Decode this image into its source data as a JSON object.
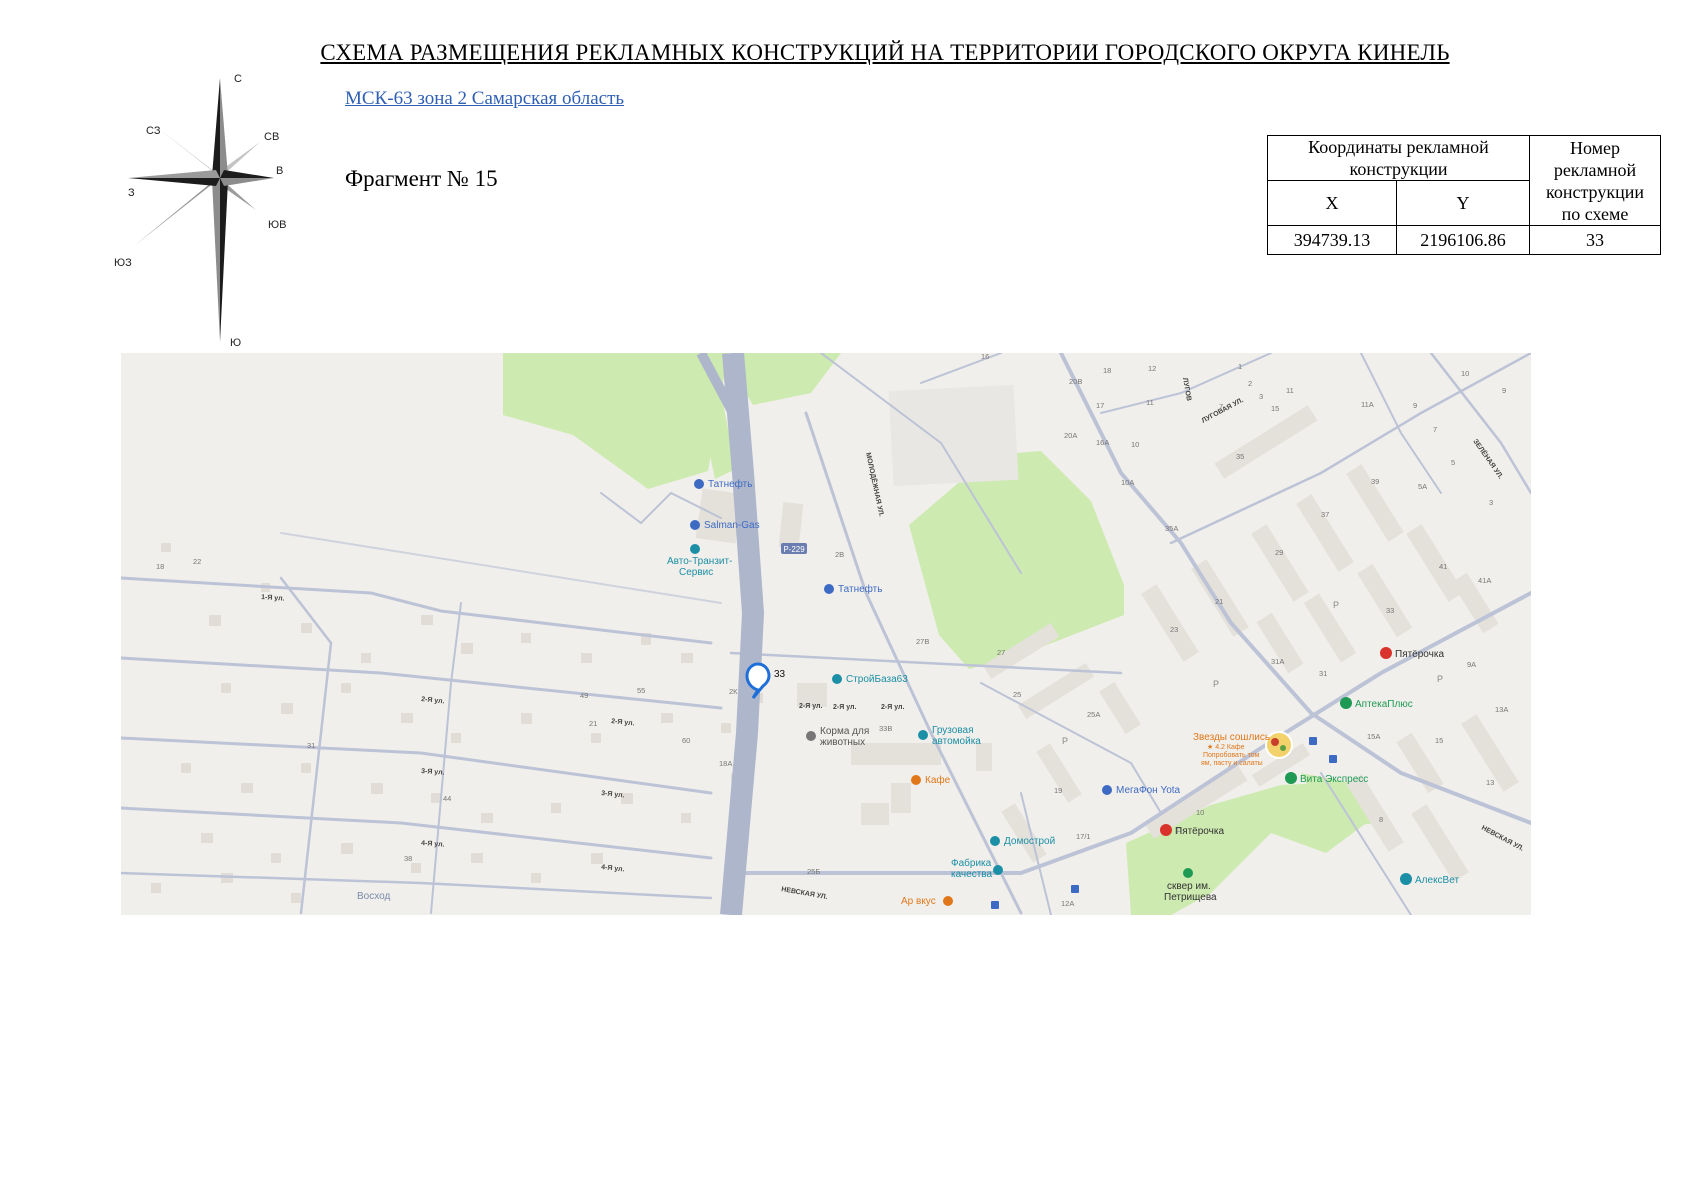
{
  "header": {
    "title": "СХЕМА РАЗМЕЩЕНИЯ РЕКЛАМНЫХ КОНСТРУКЦИЙ НА ТЕРРИТОРИИ ГОРОДСКОГО ОКРУГА КИНЕЛЬ",
    "crs_link": "МСК-63 зона 2 Самарская область",
    "fragment": "Фрагмент № 15"
  },
  "compass": {
    "labels": {
      "n": "С",
      "ne": "СВ",
      "e": "В",
      "se": "ЮВ",
      "s": "Ю",
      "sw": "ЮЗ",
      "w": "З",
      "nw": "СЗ"
    }
  },
  "coords_table": {
    "header_coords": "Координаты рекламной конструкции",
    "header_number": "Номер рекламной конструкции по схеме",
    "col_x": "X",
    "col_y": "Y",
    "rows": [
      {
        "x": "394739.13",
        "y": "2196106.86",
        "number": "33"
      }
    ]
  },
  "map": {
    "marker_label": "33",
    "colors": {
      "park": "#cdeab0",
      "road": "#bcc3d6",
      "highway": "#aeb6cc",
      "building": "#e4e0da",
      "marker": "#1e6fd9",
      "poi_blue": "#3d6bc4",
      "poi_green": "#1f9a55",
      "poi_teal": "#1b8fa6",
      "poi_orange": "#e0781b",
      "poi_red": "#d9342b"
    },
    "route_badge": "Р-229",
    "pois": [
      {
        "name": "Татнефть",
        "icon": "fuel-icon"
      },
      {
        "name": "Salman-Gas",
        "icon": "fuel-icon"
      },
      {
        "name": "Авто-Транзит-",
        "icon": "bus-icon"
      },
      {
        "name": "Сервис",
        "icon": "bus-icon"
      },
      {
        "name": "Татнефть",
        "icon": "fuel-icon"
      },
      {
        "name": "СтройБаза63",
        "icon": "shop-icon"
      },
      {
        "name": "Корма для",
        "icon": "pet-food-icon"
      },
      {
        "name": "животных",
        "icon": "pet-food-icon"
      },
      {
        "name": "Грузовая",
        "icon": "car-service-icon"
      },
      {
        "name": "автомойка",
        "icon": "car-service-icon"
      },
      {
        "name": "Кафе",
        "icon": "cafe-icon"
      },
      {
        "name": "Домострой",
        "icon": "shop-icon"
      },
      {
        "name": "Фабрика",
        "icon": "shop-icon"
      },
      {
        "name": "качества",
        "icon": "shop-icon"
      },
      {
        "name": "Ар вкус",
        "icon": "cafe-icon"
      },
      {
        "name": "МегаФон Yota",
        "icon": "phone-icon"
      },
      {
        "name": "Пятёрочка",
        "icon": "supermarket-icon"
      },
      {
        "name": "Пятёрочка",
        "icon": "supermarket-icon"
      },
      {
        "name": "АптекаПлюс",
        "icon": "pharmacy-icon"
      },
      {
        "name": "Вита Экспресс",
        "icon": "pharmacy-icon"
      },
      {
        "name": "АлексВет",
        "icon": "vet-icon"
      },
      {
        "name": "Звезды сошлись",
        "icon": "restaurant-icon"
      },
      {
        "name": "сквер им.",
        "icon": "park-icon"
      },
      {
        "name": "Петрищева",
        "icon": "park-icon"
      }
    ],
    "promo_lines": [
      "★ 4.2 Кафе",
      "Попробовать том",
      "ям, пасту и салаты"
    ],
    "streets": [
      "1-Я ул.",
      "2-Я ул.",
      "2-Я ул.",
      "3-Я ул.",
      "3-Я ул.",
      "4-Я ул.",
      "4-Я ул.",
      "2-Я ул.",
      "2-Я ул.",
      "2-Я ул.",
      "НЕВСКАЯ УЛ.",
      "НЕВСКАЯ УЛ.",
      "МОЛОДЁЖНАЯ УЛ.",
      "ЛУГОВАЯ УЛ.",
      "ЛУГОВ",
      "ЗЕЛЁНАЯ УЛ."
    ],
    "places": [
      "Восход"
    ],
    "house_numbers": [
      "18",
      "22",
      "31",
      "49",
      "55",
      "21",
      "60",
      "18А",
      "44",
      "38",
      "2К",
      "2В",
      "27В",
      "33В",
      "25Б",
      "27",
      "25",
      "25А",
      "23",
      "21",
      "29",
      "37",
      "39",
      "35",
      "35А",
      "31А",
      "31",
      "33",
      "41",
      "41А",
      "15А",
      "15",
      "13",
      "13А",
      "9А",
      "10А",
      "16",
      "20В",
      "18",
      "12",
      "17",
      "11",
      "20А",
      "16А",
      "10",
      "11",
      "11А",
      "9",
      "7",
      "5",
      "5А",
      "3",
      "10",
      "8",
      "19",
      "17/1",
      "12А",
      "10",
      "1",
      "2",
      "3",
      "7",
      "15",
      "9"
    ]
  }
}
